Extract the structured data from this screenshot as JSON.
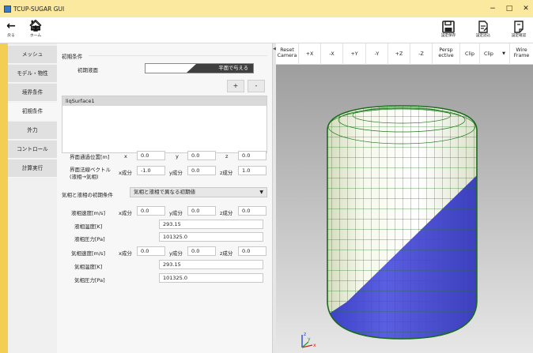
{
  "window": {
    "title": "TCUP-SUGAR GUI",
    "controls": {
      "minimize": "−",
      "maximize": "□",
      "close": "✕"
    }
  },
  "toolbar": {
    "back_label": "戻る",
    "home_label": "ホーム",
    "save_settings": "設定保存",
    "load_settings": "設定読込",
    "confirm_settings": "設定確認"
  },
  "sidebar": {
    "items": [
      {
        "label": "メッシュ"
      },
      {
        "label": "モデル・物性"
      },
      {
        "label": "境界条件"
      },
      {
        "label": "初期条件"
      },
      {
        "label": "外力"
      },
      {
        "label": "コントロール"
      },
      {
        "label": "計算実行"
      }
    ],
    "active_index": 3
  },
  "form": {
    "section_title": "初期条件",
    "initial_surface_label": "初期液面",
    "toggle_option": "平面で与える",
    "add_label": "+",
    "remove_label": "-",
    "surfaces": [
      "liqSurface1"
    ],
    "pass_point": {
      "label": "界面通過位置[m]",
      "x_label": "x",
      "x": "0.0",
      "y_label": "y",
      "y": "0.0",
      "z_label": "z",
      "z": "0.0"
    },
    "normal": {
      "label_line1": "界面法線ベクトル",
      "label_line2": "(液相→気相)",
      "x_label": "x成分",
      "x": "-1.0",
      "y_label": "y成分",
      "y": "0.0",
      "z_label": "z成分",
      "z": "1.0"
    },
    "phase_condition_label": "気相と液相の初期条件",
    "phase_condition_value": "気相と液相で異なる初期値",
    "liquid_velocity": {
      "label": "液相速度[m/s]",
      "x_label": "x成分",
      "x": "0.0",
      "y_label": "y成分",
      "y": "0.0",
      "z_label": "z成分",
      "z": "0.0"
    },
    "liquid_temperature": {
      "label": "液相温度[K]",
      "value": "293.15"
    },
    "liquid_pressure": {
      "label": "液相圧力[Pa]",
      "value": "101325.0"
    },
    "gas_velocity": {
      "label": "気相速度[m/s]",
      "x_label": "x成分",
      "x": "0.0",
      "y_label": "y成分",
      "y": "0.0",
      "z_label": "z成分",
      "z": "0.0"
    },
    "gas_temperature": {
      "label": "気相温度[K]",
      "value": "293.15"
    },
    "gas_pressure": {
      "label": "気相圧力[Pa]",
      "value": "101325.0"
    }
  },
  "viewport": {
    "buttons": [
      {
        "line1": "Reset",
        "line2": "Camera"
      },
      {
        "line1": "+X",
        "line2": ""
      },
      {
        "line1": "-X",
        "line2": ""
      },
      {
        "line1": "+Y",
        "line2": ""
      },
      {
        "line1": "-Y",
        "line2": ""
      },
      {
        "line1": "+Z",
        "line2": ""
      },
      {
        "line1": "-Z",
        "line2": ""
      },
      {
        "line1": "Persp",
        "line2": "ective"
      },
      {
        "line1": "Clip",
        "line2": ""
      },
      {
        "line1": "Clip",
        "line2": ""
      },
      {
        "line1": "Wire",
        "line2": "Frame"
      }
    ],
    "axis_labels": {
      "x": "x",
      "y": "y",
      "z": "z"
    },
    "colors": {
      "liquid": "#5054d8",
      "gas": "#f2f6e6",
      "mesh": "#1a7a1a",
      "axis_x": "#d02020",
      "axis_y": "#20a020",
      "axis_z": "#2040d0"
    }
  }
}
